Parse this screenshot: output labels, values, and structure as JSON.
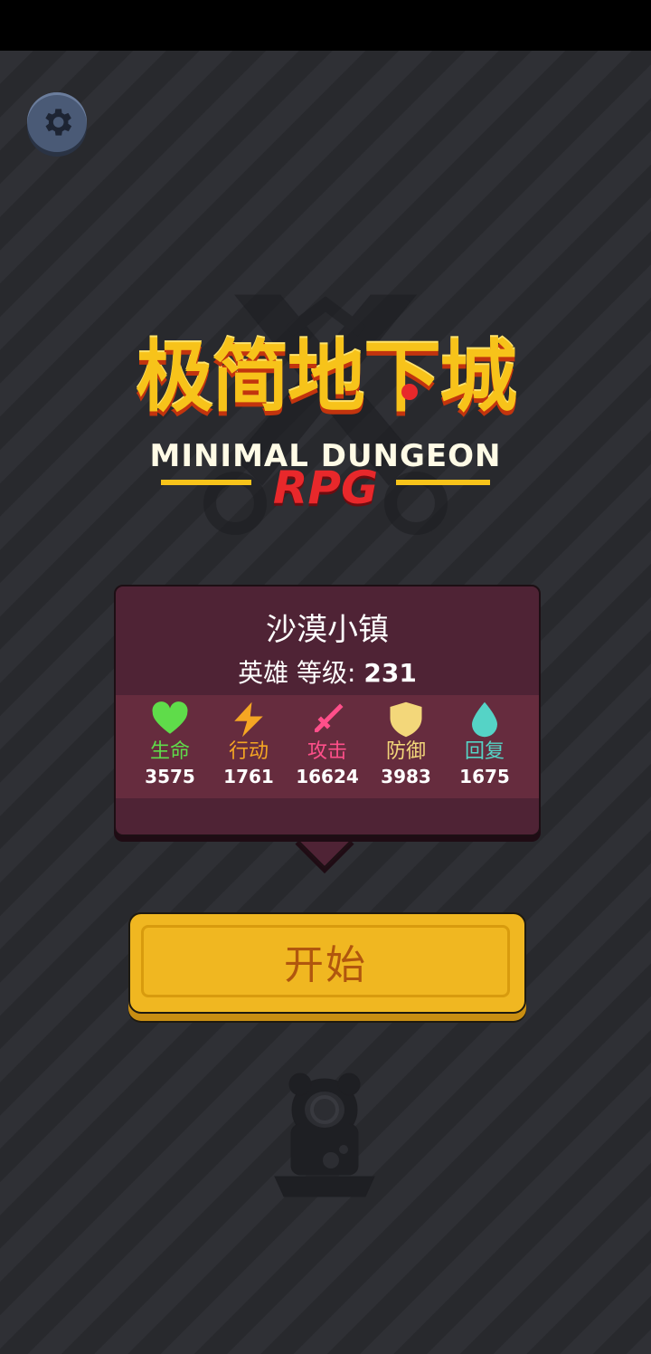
{
  "logo": {
    "title_cn": "极简地下城",
    "title_en": "MINIMAL DUNGEON",
    "subtitle": "RPG"
  },
  "card": {
    "location": "沙漠小镇",
    "hero_label": "英雄 等级: ",
    "hero_level": "231",
    "stats": [
      {
        "icon": "heart-icon",
        "label": "生命",
        "value": "3575",
        "color": "#5fdc4a"
      },
      {
        "icon": "lightning-icon",
        "label": "行动",
        "value": "1761",
        "color": "#f5a623"
      },
      {
        "icon": "sword-icon",
        "label": "攻击",
        "value": "16624",
        "color": "#ff4f8a"
      },
      {
        "icon": "shield-icon",
        "label": "防御",
        "value": "3983",
        "color": "#f3d77a"
      },
      {
        "icon": "water-drop-icon",
        "label": "回复",
        "value": "1675",
        "color": "#55d3c6"
      }
    ]
  },
  "start_button": {
    "label": "开始"
  },
  "colors": {
    "background": "#2b2c30",
    "card": "#4f2335",
    "start_button": "#f0b721",
    "logo_gold": "#f7c31a",
    "logo_red": "#e8282b"
  }
}
